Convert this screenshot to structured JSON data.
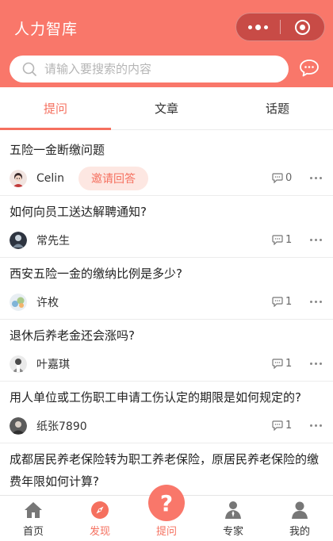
{
  "header": {
    "title": "人力智库",
    "capsule": {
      "more_icon": "more-dots-icon",
      "close_icon": "target-close-icon"
    },
    "bg_color": "#f9776a"
  },
  "search": {
    "placeholder": "请输入要搜索的内容",
    "value": "",
    "icon": "search-icon"
  },
  "chat_icon": "chat-bubble-icon",
  "tabs": [
    {
      "label": "提问",
      "active": true
    },
    {
      "label": "文章",
      "active": false
    },
    {
      "label": "话题",
      "active": false
    }
  ],
  "questions": [
    {
      "title": "五险一金断缴问题",
      "user": "Celin",
      "invite_label": "邀请回答",
      "count": "0"
    },
    {
      "title": "如何向员工送达解聘通知?",
      "user": "常先生",
      "count": "1"
    },
    {
      "title": "西安五险一金的缴纳比例是多少?",
      "user": "许枚",
      "count": "1"
    },
    {
      "title": "退休后养老金还会涨吗?",
      "user": "叶嘉琪",
      "count": "1"
    },
    {
      "title": "用人单位或工伤职工申请工伤认定的期限是如何规定的?",
      "user": "纸张7890",
      "count": "1"
    },
    {
      "title": "成都居民养老保险转为职工养老保险，原居民养老保险的缴费年限如何计算?"
    }
  ],
  "bottom_nav": [
    {
      "label": "首页",
      "icon": "home-icon"
    },
    {
      "label": "发现",
      "icon": "compass-icon",
      "active": true
    },
    {
      "label": "提问",
      "icon": "question-icon"
    },
    {
      "label": "专家",
      "icon": "expert-icon"
    },
    {
      "label": "我的",
      "icon": "profile-icon"
    }
  ],
  "accent_color": "#f5705f"
}
